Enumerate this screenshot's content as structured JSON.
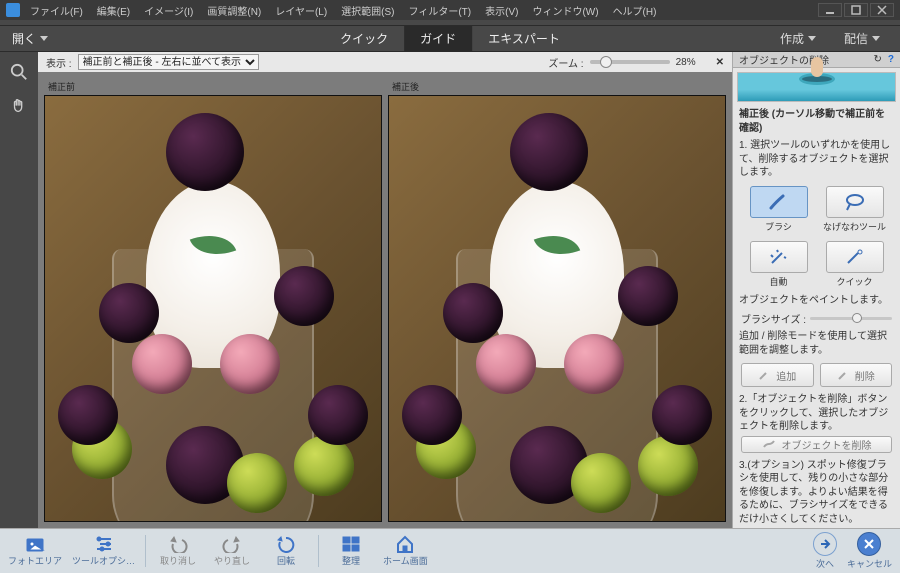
{
  "menubar": {
    "items": [
      "ファイル(F)",
      "編集(E)",
      "イメージ(I)",
      "画質調整(N)",
      "レイヤー(L)",
      "選択範囲(S)",
      "フィルター(T)",
      "表示(V)",
      "ウィンドウ(W)",
      "ヘルプ(H)"
    ]
  },
  "modebar": {
    "open": "開く",
    "tabs": [
      {
        "label": "クイック"
      },
      {
        "label": "ガイド"
      },
      {
        "label": "エキスパート"
      }
    ],
    "right": [
      {
        "label": "作成"
      },
      {
        "label": "配信"
      }
    ]
  },
  "dispbar": {
    "label": "表示 :",
    "selected": "補正前と補正後 - 左右に並べて表示",
    "zoomLabel": "ズーム :",
    "zoomPct": "28%"
  },
  "panes": {
    "before": "補正前",
    "after": "補正後"
  },
  "panel": {
    "title": "オブジェクトの削除",
    "caption": "補正後 (カーソル移動で補正前を確認)",
    "step1": "1. 選択ツールのいずれかを使用して、削除するオブジェクトを選択します。",
    "tools": [
      {
        "label": "ブラシ"
      },
      {
        "label": "なげなわツール"
      },
      {
        "label": "自動"
      },
      {
        "label": "クイック"
      }
    ],
    "paintLabel": "オブジェクトをペイントします。",
    "brushSize": "ブラシサイズ :",
    "step1b": "追加 / 削除モードを使用して選択範囲を調整します。",
    "addBtn": "追加",
    "delBtn": "削除",
    "step2": "2.「オブジェクトを削除」ボタンをクリックして、選択したオブジェクトを削除します。",
    "removeBtn": "オブジェクトを削除",
    "step3": "3.(オプション) スポット修復ブラシを使用して、残りの小さな部分を修復します。よりよい結果を得るために、ブラシサイズをできるだけ小さくしてください。"
  },
  "bottombar": {
    "items": [
      "フォトエリア",
      "ツールオプシ…",
      "取り消し",
      "やり直し",
      "回転",
      "整理",
      "ホーム画面"
    ],
    "next": "次へ",
    "cancel": "キャンセル"
  }
}
